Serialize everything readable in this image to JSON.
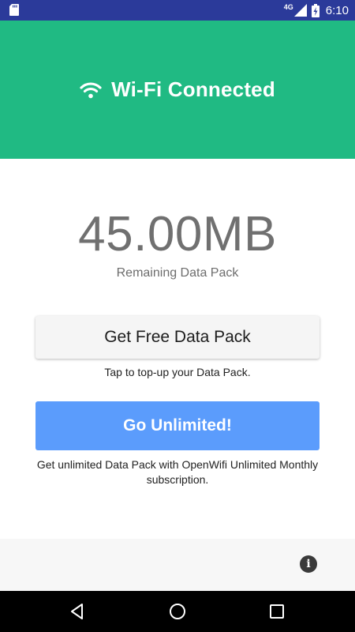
{
  "status_bar": {
    "network_type": "4G",
    "time": "6:10",
    "icons": [
      "sd-card-icon",
      "signal-icon",
      "battery-charging-icon"
    ]
  },
  "header": {
    "icon": "wifi-icon",
    "title": "Wi-Fi Connected",
    "background_color": "#20ba83"
  },
  "data_pack": {
    "amount": "45.00MB",
    "caption": "Remaining Data Pack"
  },
  "free_pack": {
    "button_label": "Get Free Data Pack",
    "caption": "Tap to top-up your Data Pack."
  },
  "unlimited": {
    "button_label": "Go Unlimited!",
    "caption": "Get unlimited Data Pack with OpenWifi Unlimited Monthly subscription.",
    "button_color": "#5b9cfc"
  },
  "footer": {
    "icon": "info-icon"
  },
  "navigation": {
    "icons": [
      "back-icon",
      "home-icon",
      "recent-apps-icon"
    ]
  }
}
